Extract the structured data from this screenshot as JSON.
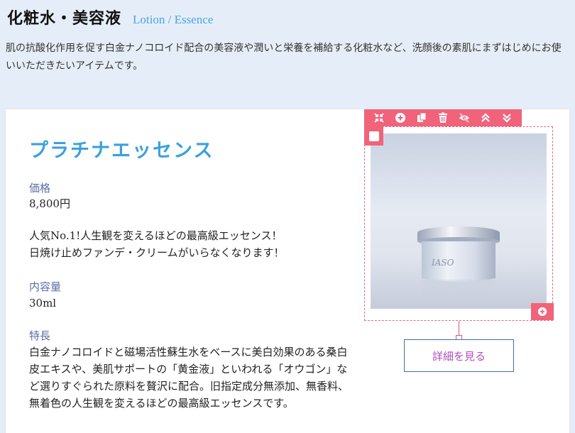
{
  "section": {
    "title": "化粧水・美容液",
    "subtitle": "Lotion / Essence",
    "description": "肌の抗酸化作用を促す白金ナノコロイド配合の美容液や潤いと栄養を補給する化粧水など、洗顔後の素肌にまずはじめにお使いいただきたいアイテムです。"
  },
  "product": {
    "name": "プラチナエッセンス",
    "price_label": "価格",
    "price_value": "8,800円",
    "catch_line1": "人気No.1!人生観を変えるほどの最高級エッセンス！",
    "catch_line2": "日焼け止めファンデ・クリームがいらなくなります！",
    "volume_label": "内容量",
    "volume_value": "30ml",
    "feature_label": "特長",
    "feature_text": "白金ナノコロイドと磁場活性蘇生水をベースに美白効果のある桑白皮エキスや、美肌サポートの「黄金液」といわれる「オウゴン」など選りすぐられた原料を贅沢に配合。旧指定成分無添加、無香料、無着色の人生観を変えるほどの最高級エッセンスです。",
    "detail_button": "詳細を見る",
    "jar_brand": "IASO"
  },
  "toolbar": {
    "icons": [
      "shrink-icon",
      "add-circle-icon",
      "copy-icon",
      "trash-icon",
      "hide-icon",
      "move-up-icon",
      "move-down-icon"
    ]
  },
  "colors": {
    "accent": "#f0637a",
    "title_blue": "#3aa0e0",
    "label_blue": "#5a6fa8",
    "button_text": "#b04fbf",
    "page_bg": "#e5eef8"
  }
}
